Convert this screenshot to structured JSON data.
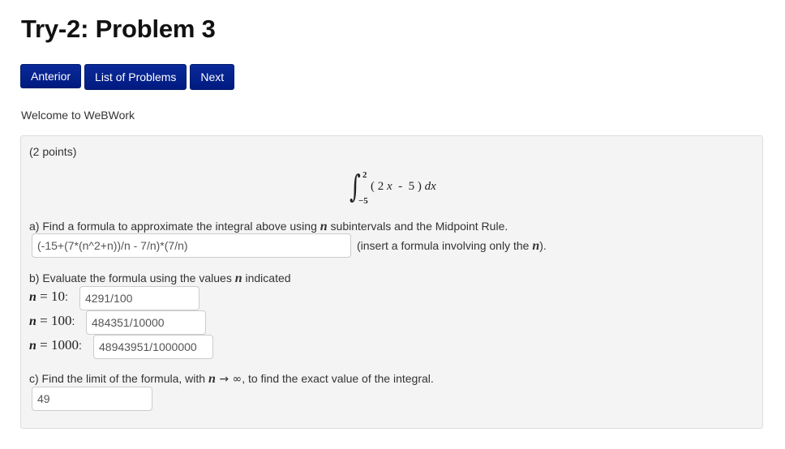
{
  "page": {
    "title": "Try-2: Problem 3",
    "welcome": "Welcome to WeBWork"
  },
  "nav": {
    "previous_label": "Anterior",
    "list_label": "List of Problems",
    "next_label": "Next"
  },
  "problem": {
    "points": "(2 points)",
    "integral": {
      "upper_limit": "2",
      "lower_limit": "−5",
      "integrand_open": "( 2 ",
      "integrand_var": "x",
      "integrand_rest": "  -  5 ) ",
      "differential": "dx"
    },
    "part_a": {
      "prompt_before": "a) Find a formula to approximate the integral above using ",
      "variable": "n",
      "prompt_after": " subintervals and the Midpoint Rule.",
      "answer": "(-15+(7*(n^2+n))/n - 7/n)*(7/n)",
      "hint_before": "(insert a formula involving only the ",
      "hint_var": "n",
      "hint_after": ")."
    },
    "part_b": {
      "prompt_before": "b) Evaluate the formula using the values ",
      "variable": "n",
      "prompt_after": " indicated",
      "rows": [
        {
          "n_label": "n",
          "eq": " = ",
          "value": "10",
          "answer": "4291/100"
        },
        {
          "n_label": "n",
          "eq": " = ",
          "value": "100",
          "answer": "484351/10000"
        },
        {
          "n_label": "n",
          "eq": " = ",
          "value": "1000",
          "answer": "48943951/1000000"
        }
      ],
      "colon": ":"
    },
    "part_c": {
      "prompt_before": "c) Find the limit of the formula, with ",
      "variable": "n",
      "arrow": " → ",
      "infinity": "∞",
      "prompt_after": ", to find the exact value of the integral.",
      "answer": "49"
    }
  }
}
